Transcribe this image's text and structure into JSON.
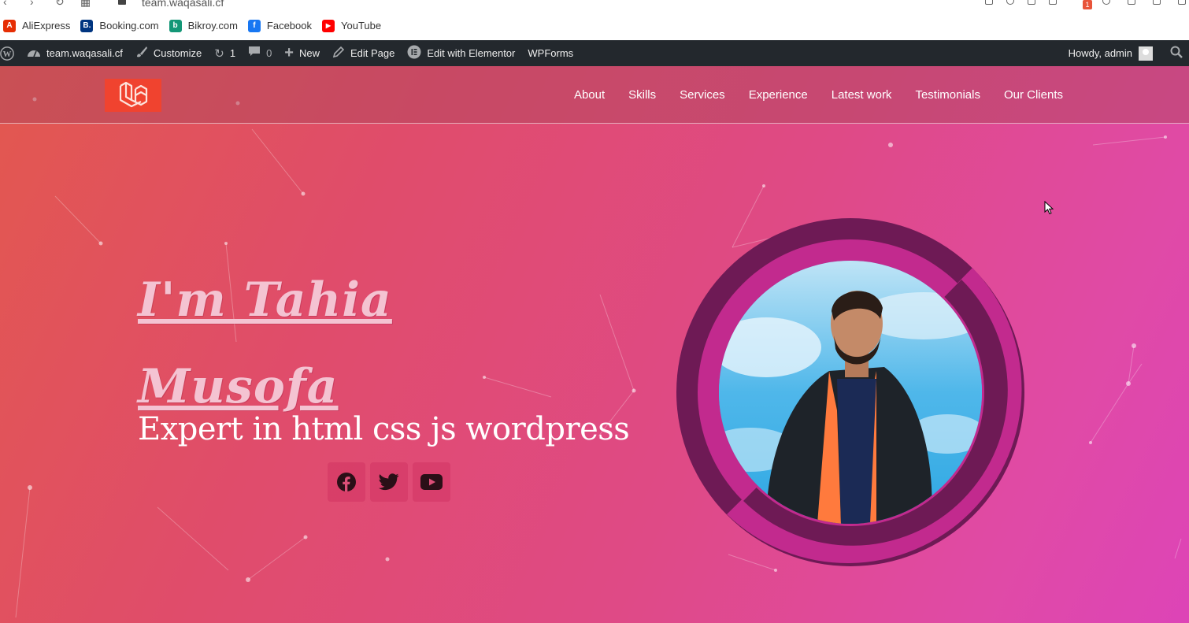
{
  "browser": {
    "url": "team.waqasali.cf",
    "extension_badge": "1",
    "bookmarks": [
      {
        "label": "AliExpress",
        "icon": "aliexpress-icon",
        "color": "#e62e04",
        "glyph": "A"
      },
      {
        "label": "Booking.com",
        "icon": "booking-icon",
        "color": "#003580",
        "glyph": "B."
      },
      {
        "label": "Bikroy.com",
        "icon": "bikroy-icon",
        "color": "#149777",
        "glyph": "b"
      },
      {
        "label": "Facebook",
        "icon": "facebook-icon",
        "color": "#1877f2",
        "glyph": "f"
      },
      {
        "label": "YouTube",
        "icon": "youtube-icon",
        "color": "#ff0000",
        "glyph": "▶"
      }
    ]
  },
  "adminbar": {
    "site_name": "team.waqasali.cf",
    "customize": "Customize",
    "updates_count": "1",
    "comments_count": "0",
    "new": "New",
    "edit_page": "Edit Page",
    "elementor": "Edit with Elementor",
    "wpforms": "WPForms",
    "greeting": "Howdy, admin"
  },
  "header": {
    "menu": [
      "About",
      "Skills",
      "Services",
      "Experience",
      "Latest work",
      "Testimonials",
      "Our Clients"
    ]
  },
  "hero": {
    "headline_line1": "I'm Tahia",
    "headline_line2": "Musofa",
    "subheadline": "Expert in html css js wordpress",
    "social": [
      "facebook-icon",
      "twitter-icon",
      "youtube-icon"
    ]
  },
  "colors": {
    "accent": "#f0432f",
    "ring_dark": "#6e1a55",
    "ring_light": "#c22a8e",
    "admin_bar": "#23282d"
  }
}
